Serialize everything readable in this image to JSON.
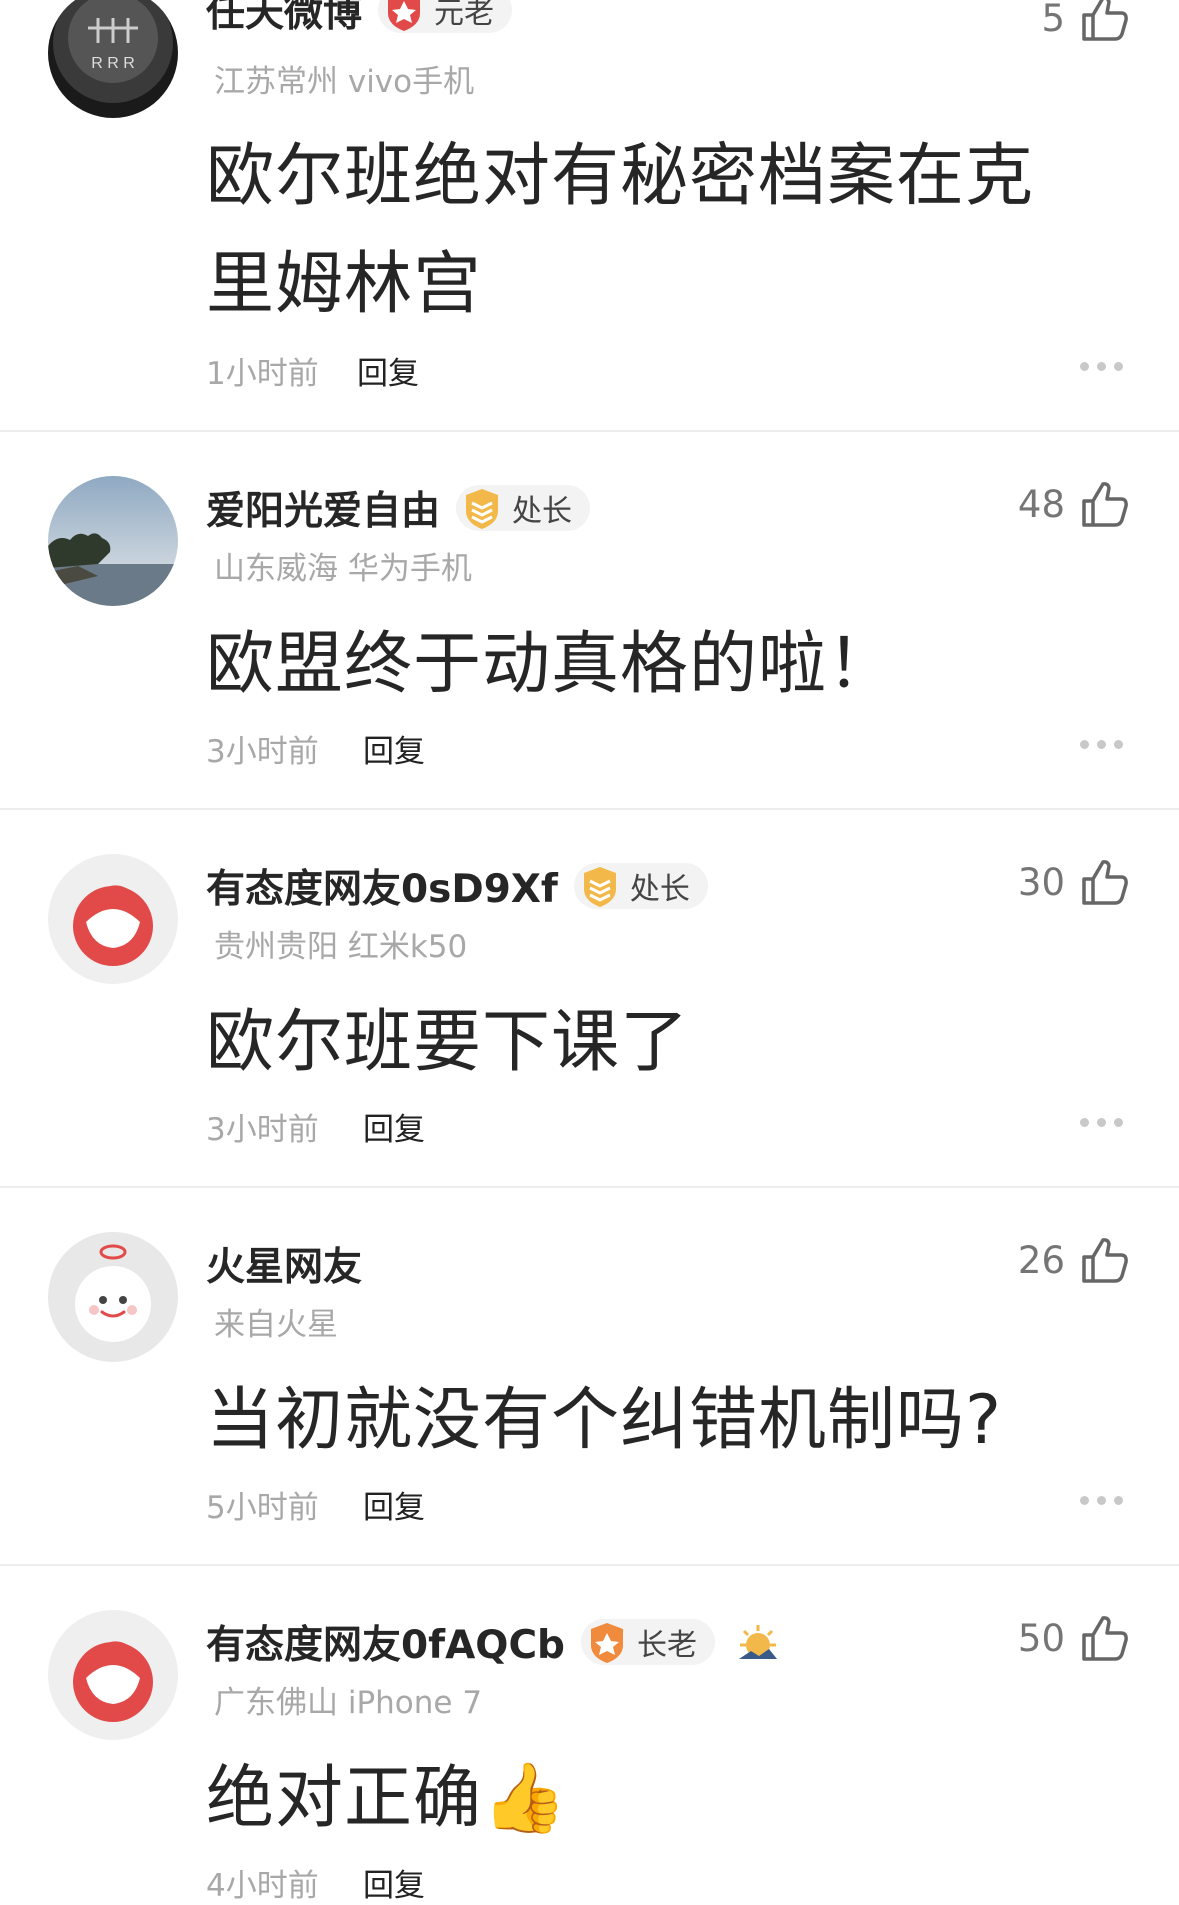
{
  "comments": [
    {
      "author": "任天微博",
      "badge": "元老",
      "location": "江苏常州 vivo手机",
      "text_lines": [
        "欧尔班绝对有秘密档案在克",
        "里姆林宫"
      ],
      "likes": "5",
      "time": "1小时前",
      "reply": "回复"
    },
    {
      "author": "爱阳光爱自由",
      "badge": "处长",
      "location": "山东威海 华为手机",
      "text_lines": [
        "欧盟终于动真格的啦！"
      ],
      "likes": "48",
      "time": "3小时前",
      "reply": "回复"
    },
    {
      "author": "有态度网友0sD9Xf",
      "badge": "处长",
      "location": "贵州贵阳 红米k50",
      "text_lines": [
        "欧尔班要下课了"
      ],
      "likes": "30",
      "time": "3小时前",
      "reply": "回复"
    },
    {
      "author": "火星网友",
      "location": "来自火星",
      "text_lines": [
        "当初就没有个纠错机制吗?"
      ],
      "likes": "26",
      "time": "5小时前",
      "reply": "回复"
    },
    {
      "author": "有态度网友0fAQCb",
      "badge": "长老",
      "location": "广东佛山 iPhone 7",
      "text_lines": [
        "绝对正确👍"
      ],
      "likes": "50",
      "time": "4小时前",
      "reply": "回复"
    }
  ],
  "colors": {
    "accent_red": "#e24a4a",
    "badge_gold": "#f2b94a",
    "meta_gray": "#a8a8a8"
  },
  "icons": [
    "thumbs-up-icon",
    "more-dots-icon",
    "rank-badge-icon",
    "sunrise-icon"
  ]
}
